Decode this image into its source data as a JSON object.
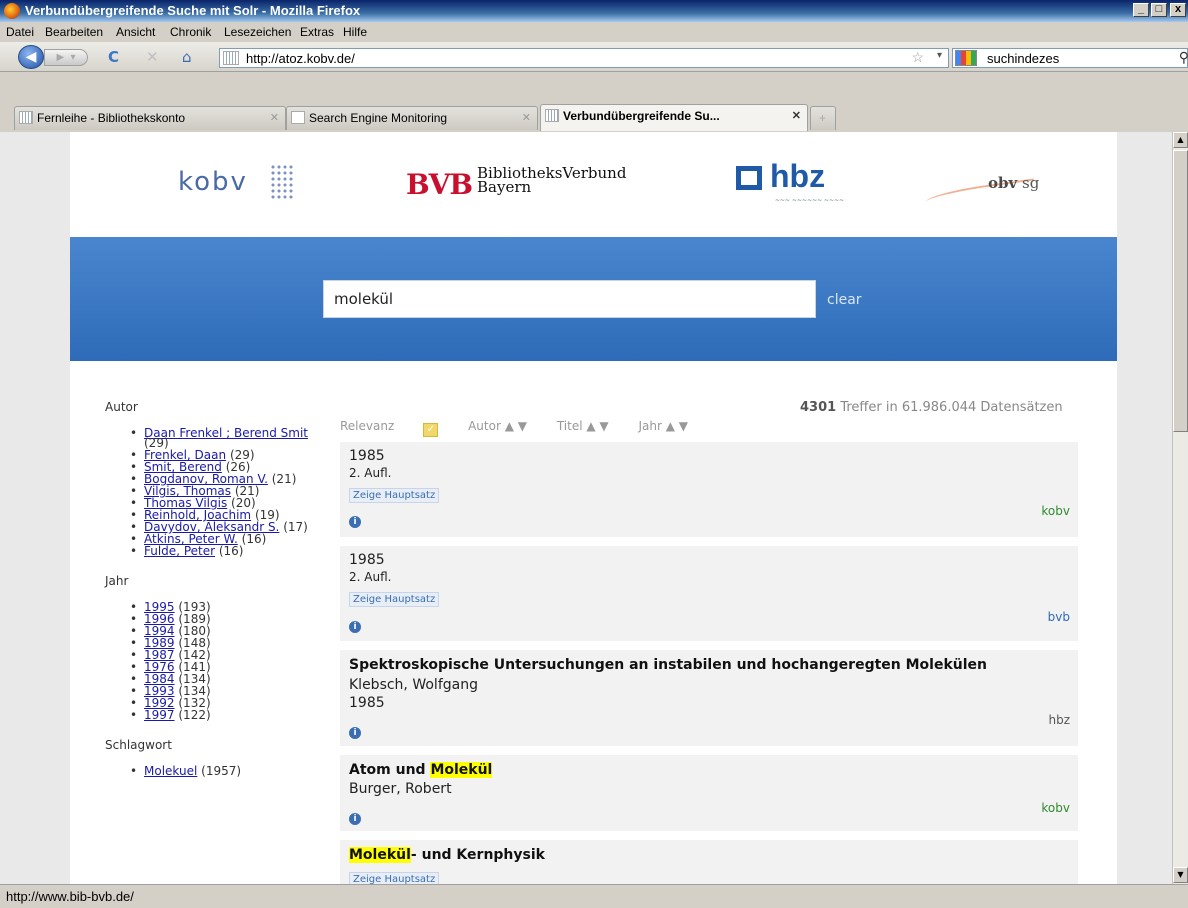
{
  "window": {
    "title": "Verbundübergreifende Suche mit Solr - Mozilla Firefox",
    "minimize": "_",
    "maximize": "□",
    "close": "x"
  },
  "menu": [
    "Datei",
    "Bearbeiten",
    "Ansicht",
    "Chronik",
    "Lesezeichen",
    "Extras",
    "Hilfe"
  ],
  "nav": {
    "url": "http://atoz.kobv.de/",
    "search_query": "suchindezes"
  },
  "tabs": [
    {
      "label": "Fernleihe - Bibliothekskonto"
    },
    {
      "label": "Search Engine Monitoring"
    },
    {
      "label": "Verbundübergreifende Su..."
    }
  ],
  "logos": {
    "kobv": "kobv",
    "bvb_mark": "BVB",
    "bvb_text_1": "BibliotheksVerbund",
    "bvb_text_2": "Bayern",
    "hbz": "hbz",
    "obv_1": "obv",
    "obv_2": "sg"
  },
  "search": {
    "query": "molekül",
    "clear_label": "clear"
  },
  "summary": {
    "count": "4301",
    "text": "Treffer in 61.986.044 Datensätzen"
  },
  "sort": [
    "Relevanz",
    "Autor ▲ ▼",
    "Titel ▲ ▼",
    "Jahr ▲ ▼"
  ],
  "facets": {
    "autor": {
      "title": "Autor",
      "items": [
        {
          "name": "Daan Frenkel ; Berend Smit",
          "count": "(29)"
        },
        {
          "name": "Frenkel, Daan",
          "count": "(29)"
        },
        {
          "name": "Smit, Berend",
          "count": "(26)"
        },
        {
          "name": "Bogdanov, Roman V.",
          "count": "(21)"
        },
        {
          "name": "Vilgis, Thomas",
          "count": "(21)"
        },
        {
          "name": "Thomas Vilgis",
          "count": "(20)"
        },
        {
          "name": "Reinhold, Joachim",
          "count": "(19)"
        },
        {
          "name": "Davydov, Aleksandr S.",
          "count": "(17)"
        },
        {
          "name": "Atkins, Peter W.",
          "count": "(16)"
        },
        {
          "name": "Fulde, Peter",
          "count": "(16)"
        }
      ]
    },
    "jahr": {
      "title": "Jahr",
      "items": [
        {
          "name": "1995",
          "count": "(193)"
        },
        {
          "name": "1996",
          "count": "(189)"
        },
        {
          "name": "1994",
          "count": "(180)"
        },
        {
          "name": "1989",
          "count": "(148)"
        },
        {
          "name": "1987",
          "count": "(142)"
        },
        {
          "name": "1976",
          "count": "(141)"
        },
        {
          "name": "1984",
          "count": "(134)"
        },
        {
          "name": "1993",
          "count": "(134)"
        },
        {
          "name": "1992",
          "count": "(132)"
        },
        {
          "name": "1997",
          "count": "(122)"
        }
      ]
    },
    "schlagwort": {
      "title": "Schlagwort",
      "items": [
        {
          "name": "Molekuel",
          "count": "(1957)"
        }
      ]
    }
  },
  "results": [
    {
      "year": "1985",
      "edition": "2. Aufl.",
      "tag": "Zeige Hauptsatz",
      "source": "kobv"
    },
    {
      "year": "1985",
      "edition": "2. Aufl.",
      "tag": "Zeige Hauptsatz",
      "source": "bvb"
    },
    {
      "title": "Spektroskopische Untersuchungen an instabilen und hochangeregten Molekülen",
      "author": "Klebsch, Wolfgang",
      "year": "1985",
      "source": "hbz"
    },
    {
      "title_pre": "Atom und ",
      "title_hl": "Molekül",
      "author": "Burger, Robert",
      "source": "kobv"
    },
    {
      "title_hl": "Molekül",
      "title_post": "- und Kernphysik",
      "tag": "Zeige Hauptsatz"
    }
  ],
  "info_icon": "i",
  "status": "http://www.bib-bvb.de/",
  "colors": {
    "band": "#3a78c4",
    "source_kobv": "#2e8b2e",
    "source_bvb": "#2e6bb8",
    "source_hbz": "#555555",
    "highlight": "#ffff00"
  }
}
